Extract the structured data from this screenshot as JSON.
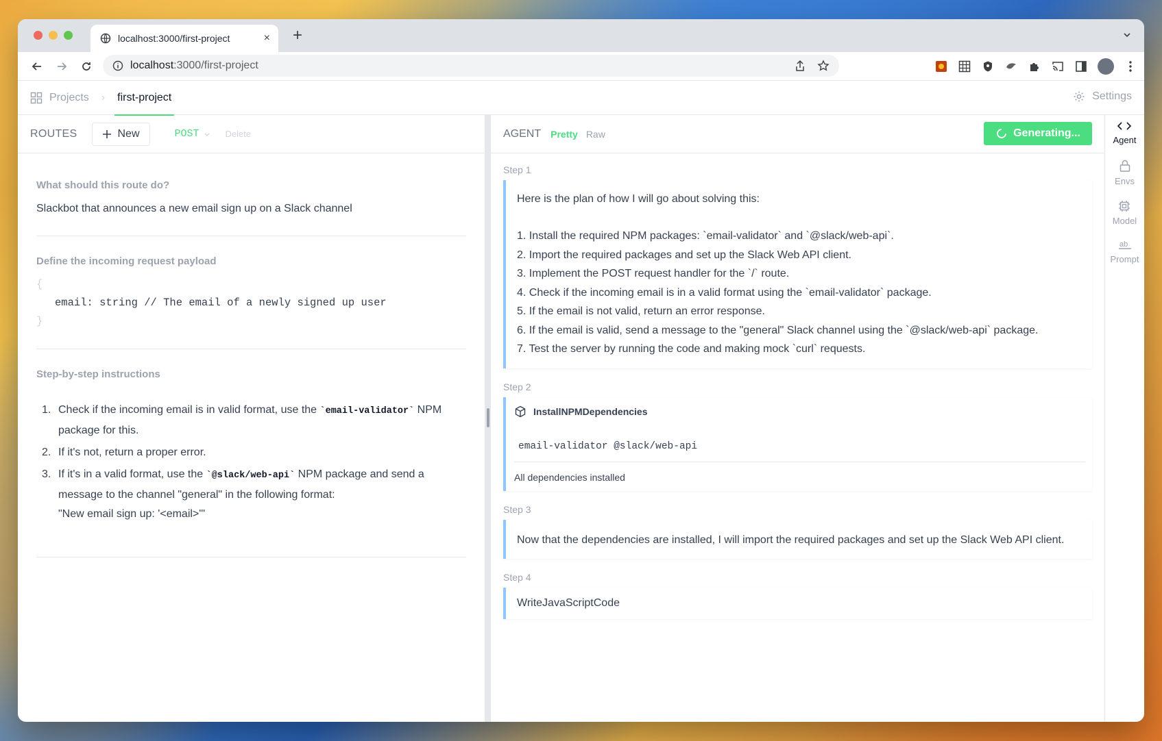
{
  "browser": {
    "tab_title": "localhost:3000/first-project",
    "tab_close": "×",
    "new_tab": "+",
    "url_host": "localhost",
    "url_path": ":3000/first-project"
  },
  "header": {
    "projects_label": "Projects",
    "current_project": "first-project",
    "settings_label": "Settings"
  },
  "left": {
    "routes_label": "ROUTES",
    "new_label": "New",
    "method": "POST",
    "delete_label": "Delete",
    "q1_title": "What should this route do?",
    "q1_answer": "Slackbot that announces a new email sign up on a Slack channel",
    "q2_title": "Define the incoming request payload",
    "payload_open": "{",
    "payload_line": "email: string // The email of a newly signed up user",
    "payload_close": "}",
    "q3_title": "Step-by-step instructions",
    "instructions": [
      {
        "num": "1.",
        "pre": "Check if the incoming email is in valid format, use the ",
        "code": "`email-validator`",
        "post": " NPM package for this."
      },
      {
        "num": "2.",
        "pre": "If it's not, return a proper error.",
        "code": "",
        "post": ""
      },
      {
        "num": "3.",
        "pre": "If it's in a valid format, use the ",
        "code": "`@slack/web-api`",
        "post": " NPM package and send a message to the channel \"general\" in the following format:",
        "extra": "\"New email sign up: '<email>'\""
      }
    ]
  },
  "agent": {
    "label": "AGENT",
    "pretty_tab": "Pretty",
    "raw_tab": "Raw",
    "generating_label": "Generating...",
    "steps": [
      {
        "label": "Step 1",
        "intro": "Here is the plan of how I will go about solving this:",
        "items": [
          "1. Install the required NPM packages: `email-validator` and `@slack/web-api`.",
          "2. Import the required packages and set up the Slack Web API client.",
          "3. Implement the POST request handler for the `/` route.",
          "4. Check if the incoming email is in a valid format using the `email-validator` package.",
          "5. If the email is not valid, return an error response.",
          "6. If the email is valid, send a message to the \"general\" Slack channel using the `@slack/web-api` package.",
          "7. Test the server by running the code and making mock `curl` requests."
        ]
      },
      {
        "label": "Step 2",
        "tool": "InstallNPMDependencies",
        "args": "email-validator @slack/web-api",
        "result": "All dependencies installed"
      },
      {
        "label": "Step 3",
        "text": "Now that the dependencies are installed, I will import the required packages and set up the Slack Web API client."
      },
      {
        "label": "Step 4",
        "text": "WriteJavaScriptCode"
      }
    ]
  },
  "rail": {
    "agent": "Agent",
    "envs": "Envs",
    "model": "Model",
    "prompt": "Prompt"
  },
  "colors": {
    "accent_green": "#4ade80",
    "step_border": "#93c5fd"
  }
}
